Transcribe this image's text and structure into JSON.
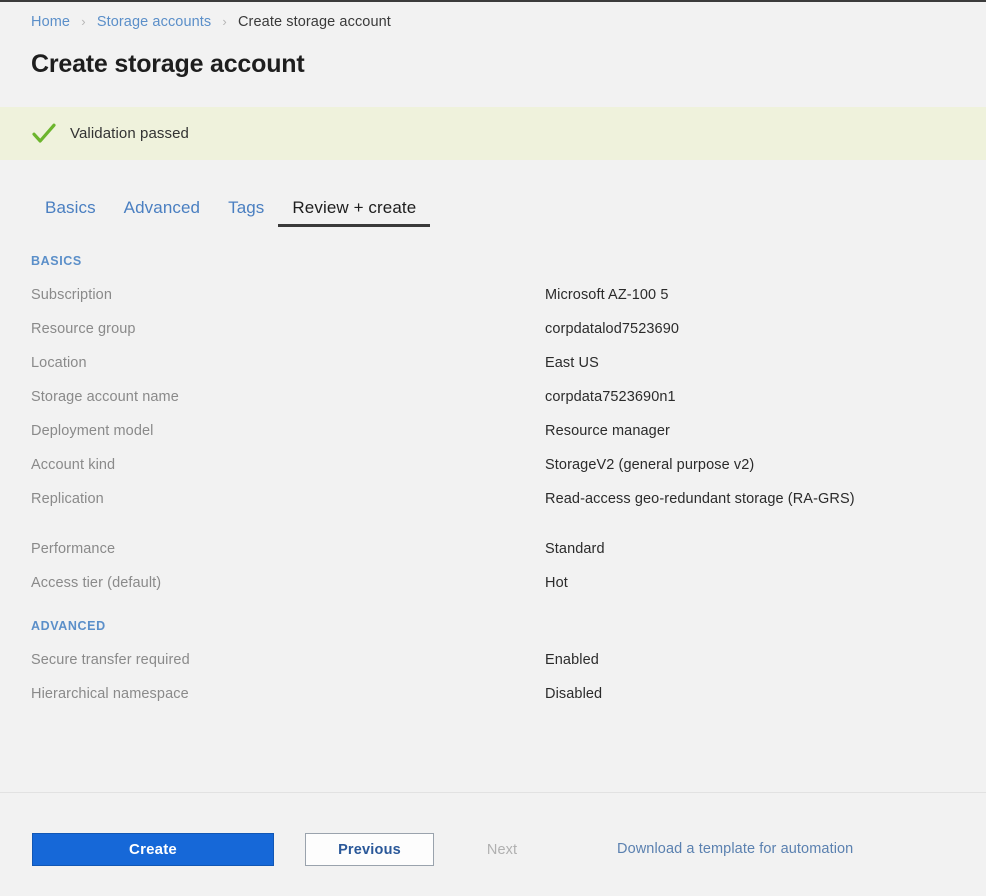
{
  "breadcrumb": {
    "separator": "›",
    "items": [
      {
        "label": "Home",
        "current": false
      },
      {
        "label": "Storage accounts",
        "current": false
      },
      {
        "label": "Create storage account",
        "current": true
      }
    ]
  },
  "header": {
    "title": "Create storage account"
  },
  "validation": {
    "icon": "checkmark-icon",
    "text": "Validation passed",
    "banner_color": "#eff2dc",
    "check_color": "#6cb52d"
  },
  "tabs": [
    {
      "label": "Basics",
      "active": false
    },
    {
      "label": "Advanced",
      "active": false
    },
    {
      "label": "Tags",
      "active": false
    },
    {
      "label": "Review + create",
      "active": true
    }
  ],
  "sections": [
    {
      "title": "BASICS",
      "rows": [
        {
          "label": "Subscription",
          "value": "Microsoft AZ-100 5"
        },
        {
          "label": "Resource group",
          "value": "corpdatalod7523690"
        },
        {
          "label": "Location",
          "value": "East US"
        },
        {
          "label": "Storage account name",
          "value": "corpdata7523690n1"
        },
        {
          "label": "Deployment model",
          "value": "Resource manager"
        },
        {
          "label": "Account kind",
          "value": "StorageV2 (general purpose v2)"
        },
        {
          "label": "Replication",
          "value": "Read-access geo-redundant storage (RA-GRS)"
        },
        {
          "label": "Performance",
          "value": "Standard"
        },
        {
          "label": "Access tier (default)",
          "value": "Hot"
        }
      ]
    },
    {
      "title": "ADVANCED",
      "rows": [
        {
          "label": "Secure transfer required",
          "value": "Enabled"
        },
        {
          "label": "Hierarchical namespace",
          "value": "Disabled"
        }
      ]
    }
  ],
  "footer": {
    "create_label": "Create",
    "previous_label": "Previous",
    "next_label": "Next",
    "download_link_label": "Download a template for automation",
    "create_color": "#1668d8",
    "link_color": "#5b81b0"
  }
}
